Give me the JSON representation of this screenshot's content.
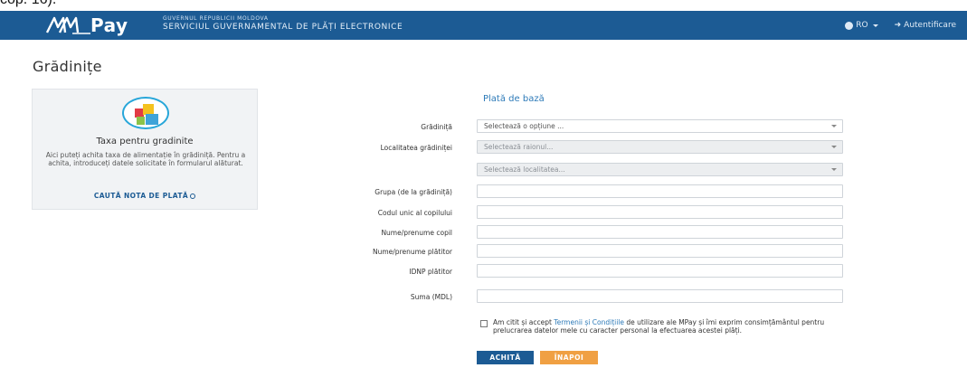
{
  "top_strip": {
    "text": "cop. 16)."
  },
  "header": {
    "logo_text": "Pay",
    "gov_line1": "GUVERNUL REPUBLICII MOLDOVA",
    "gov_line2": "SERVICIUL GUVERNAMENTAL DE PLĂȚI ELECTRONICE",
    "lang_label": "RO",
    "auth_label": "Autentificare"
  },
  "page": {
    "title": "Grădinițe"
  },
  "service": {
    "name": "Taxa pentru gradinite",
    "description": "Aici puteți achita taxa de alimentație în grădiniță. Pentru a achita, introduceți datele solicitate în formularul alăturat.",
    "find_note_label": "CAUTĂ NOTA DE PLATĂ"
  },
  "form": {
    "section_title": "Plată de bază",
    "kindergarten_label": "Grădiniță",
    "kindergarten_placeholder": "Selectează o opțiune ...",
    "locality_label": "Localitatea grădiniței",
    "district_placeholder": "Selectează raionul...",
    "locality_placeholder": "Selectează localitatea...",
    "group_label": "Grupa (de la grădiniță)",
    "child_code_label": "Codul unic al copilului",
    "child_name_label": "Nume/prenume copil",
    "payer_name_label": "Nume/prenume plătitor",
    "payer_idnp_label": "IDNP plătitor",
    "amount_label": "Suma (MDL)",
    "terms_prefix": "Am citit și accept ",
    "terms_link": "Termenii și Condițiile",
    "terms_suffix": " de utilizare ale MPay și îmi exprim consimțământul pentru prelucrarea datelor mele cu caracter personal la efectuarea acestei plăți.",
    "pay_button": "ACHITĂ",
    "back_button": "ÎNAPOI"
  },
  "colors": {
    "header_bg": "#1c5b94",
    "accent": "#2d7ab8",
    "back_button": "#f0a043"
  },
  "icons": {
    "language": "globe-icon",
    "auth": "sign-in-icon",
    "search": "search-icon",
    "dropdown": "chevron-down-icon"
  }
}
